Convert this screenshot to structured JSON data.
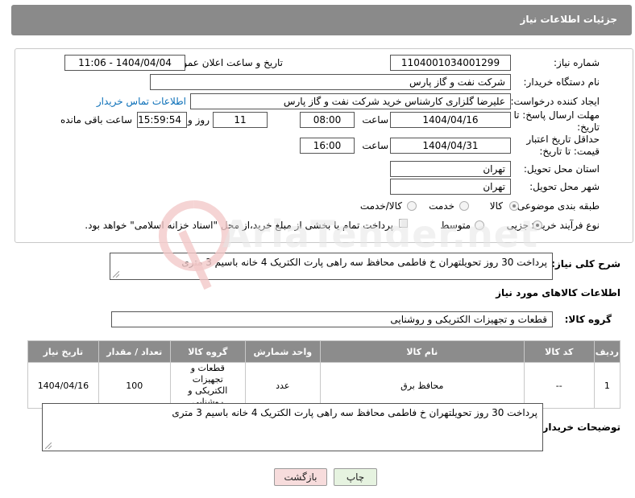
{
  "header": {
    "title": "جزئیات اطلاعات نیاز"
  },
  "form": {
    "need_number_label": "شماره نیاز:",
    "need_number": "1104001034001299",
    "announce_label": "تاریخ و ساعت اعلان عمومی:",
    "announce_value": "1404/04/04 - 11:06",
    "buyer_org_label": "نام دستگاه خریدار:",
    "buyer_org": "شرکت نفت و گاز پارس",
    "creator_label": "ایجاد کننده درخواست:",
    "creator": "علیرضا  گلزاری کارشناس خرید  شرکت نفت و گاز پارس",
    "contact_link": "اطلاعات تماس خریدار",
    "deadline_label": "مهلت ارسال پاسخ: تا تاریخ:",
    "deadline_date": "1404/04/16",
    "time_label": "ساعت",
    "deadline_time": "08:00",
    "days_value": "11",
    "days_label": "روز و",
    "remaining_time": "15:59:54",
    "remaining_label": "ساعت باقی مانده",
    "price_validity_label": "حداقل تاریخ اعتبار قیمت: تا تاریخ:",
    "price_validity_date": "1404/04/31",
    "price_validity_time": "16:00",
    "province_label": "استان محل تحویل:",
    "province": "تهران",
    "city_label": "شهر محل تحویل:",
    "city": "تهران",
    "category_label": "طبقه بندی موضوعی:",
    "category_options": [
      "کالا",
      "خدمت",
      "کالا/خدمت"
    ],
    "process_label": "نوع فرآیند خرید :",
    "process_options": [
      "جزیی",
      "متوسط"
    ],
    "payment_note": "پرداخت تمام یا بخشی از مبلغ خرید،از محل \"اسناد خزانه اسلامی\" خواهد بود."
  },
  "description": {
    "label": "شرح کلی نیاز:",
    "text": "پرداخت 30 روز تحویلتهران خ فاطمی محافظ سه راهی پارت الکتریک 4 خانه باسیم 3 متری"
  },
  "goods_section": {
    "title": "اطلاعات کالاهای مورد نیاز",
    "group_label": "گروه کالا:",
    "group_value": "قطعات و تجهیزات الکتریکی و روشنایی"
  },
  "table": {
    "headers": [
      "ردیف",
      "کد کالا",
      "نام کالا",
      "واحد شمارش",
      "گروه کالا",
      "تعداد / مقدار",
      "تاریخ نیاز"
    ],
    "rows": [
      [
        "1",
        "--",
        "محافظ برق",
        "عدد",
        "قطعات و تجهیزات الکتریکی و روشنایی",
        "100",
        "1404/04/16"
      ]
    ]
  },
  "buyer_notes": {
    "label": "توضیحات خریدار:",
    "text": "پرداخت 30 روز تحویلتهران خ فاطمی محافظ سه راهی پارت الکتریک 4 خانه باسیم 3 متری"
  },
  "buttons": {
    "print": "چاپ",
    "back": "بازگشت"
  },
  "watermark": {
    "text": "AriaTender.net"
  },
  "colors": {
    "header_bg": "#8a8a8a",
    "link": "#0b6fb8",
    "print_bg": "#e6f3e0",
    "back_bg": "#f7dcdc"
  }
}
